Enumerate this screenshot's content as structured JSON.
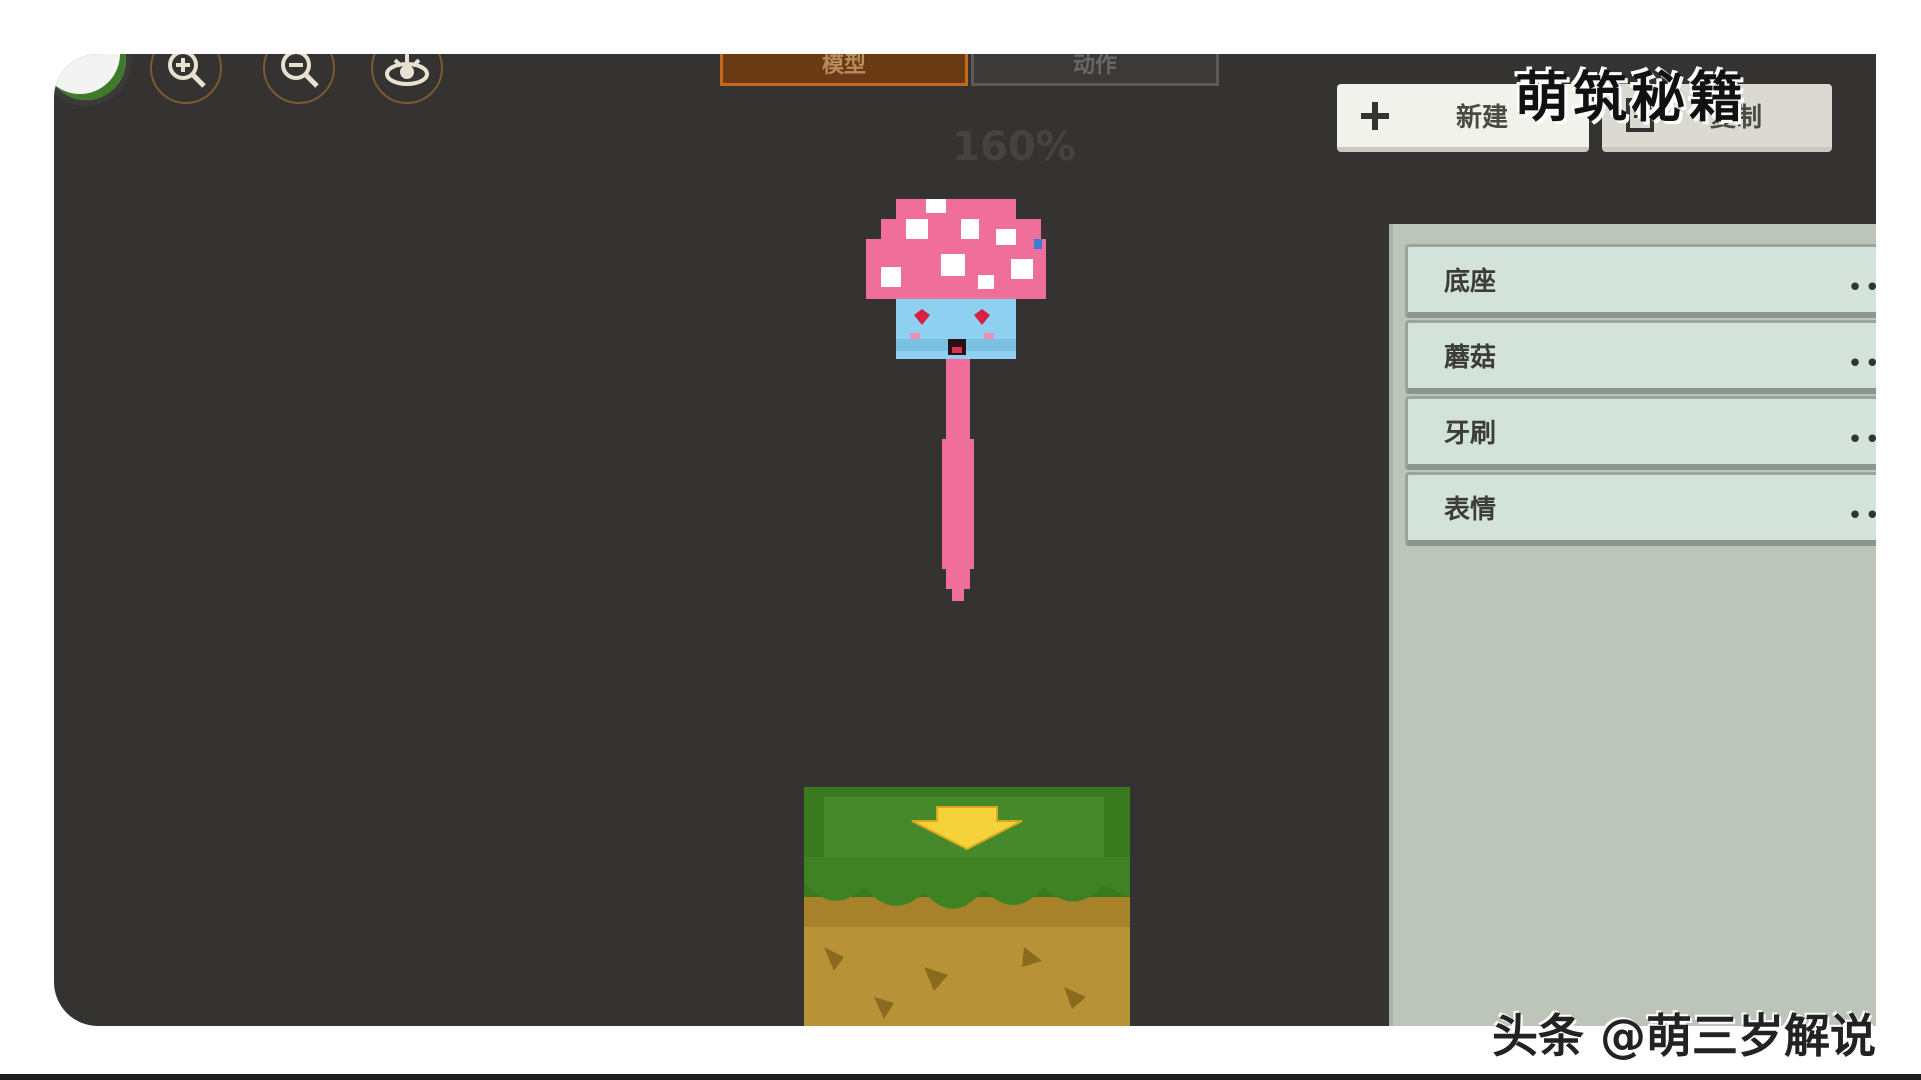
{
  "toolbar": {
    "zoom_in_icon": "zoom-in-icon",
    "zoom_out_icon": "zoom-out-icon",
    "view_icon": "eye-icon",
    "tabs": [
      {
        "label": "模型",
        "active": true
      },
      {
        "label": "动作",
        "active": false
      }
    ],
    "zoom_level": "160%"
  },
  "panel": {
    "new_label": "新建",
    "copy_label": "复制",
    "parts": [
      {
        "label": "底座"
      },
      {
        "label": "蘑菇"
      },
      {
        "label": "牙刷"
      },
      {
        "label": "表情"
      }
    ],
    "more_glyph": "••"
  },
  "overlay": {
    "watermark": "萌筑秘籍",
    "credit": "头条 @萌三岁解说"
  },
  "colors": {
    "canvas": "#353331",
    "panel": "#bdc5bb",
    "part_item": "#d3e3dc",
    "active_tab": "#c36a19",
    "mushroom_cap": "#ef6f9a",
    "mushroom_face": "#8ed0f0"
  }
}
